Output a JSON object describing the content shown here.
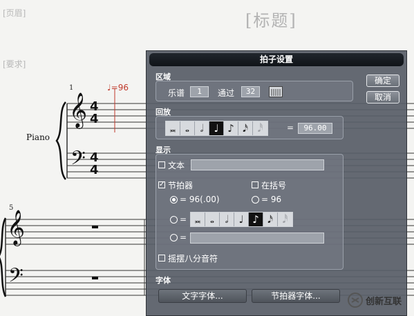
{
  "score": {
    "title": "[标题]",
    "header_placeholder": "[页眉]",
    "requirement_placeholder": "[要求]",
    "measure_1": "1",
    "measure_5": "5",
    "instrument": "Piano",
    "tempo_marking": "♩=96",
    "time_sig_top": "4",
    "time_sig_bottom": "4"
  },
  "dialog": {
    "title": "拍子设置",
    "ok_label": "确定",
    "cancel_label": "取消",
    "region": {
      "heading": "区域",
      "score_label": "乐谱",
      "score_value": "1",
      "through_label": "通过",
      "through_value": "32"
    },
    "playback": {
      "heading": "回放",
      "tempo_value": "96.00",
      "equals": "="
    },
    "display": {
      "heading": "显示",
      "text_label": "文本",
      "text_checked": false,
      "metronome_label": "节拍器",
      "metronome_checked": true,
      "parentheses_label": "在括号",
      "parentheses_checked": false,
      "option1_label": "= 96(.00)",
      "option1_selected": true,
      "option2_label": "= 96",
      "option2_selected": false,
      "option3_prefix": "=",
      "option4_prefix": "=",
      "swing_label": "摇摆八分音符",
      "swing_checked": false
    },
    "font": {
      "heading": "字体",
      "text_font_button": "文字字体...",
      "metronome_font_button": "节拍器字体..."
    },
    "note_values": [
      "𝅜",
      "𝅝",
      "𝅗𝅥",
      "♩",
      "♪",
      "𝅘𝅥𝅯",
      "𝅘𝅥𝅯"
    ],
    "selected_note_playback": 3,
    "selected_note_display": 4
  },
  "watermark": {
    "text": "创新互联"
  },
  "colors": {
    "dialog_bg": "#585e68",
    "tempo_red": "#c0392b"
  }
}
